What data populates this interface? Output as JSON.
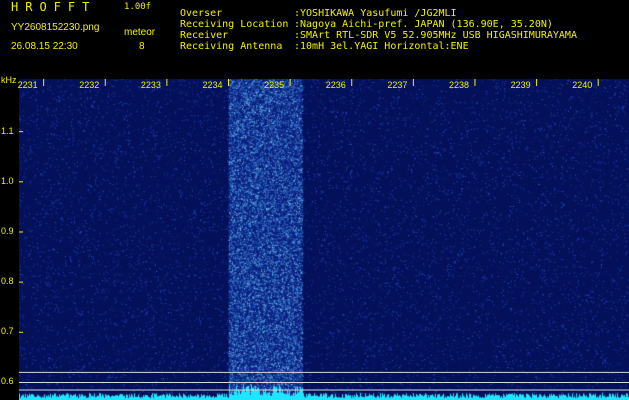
{
  "header": {
    "app_name": "HROFFT",
    "app_version": "1.00f",
    "file_name": "YY2608152230.png",
    "mode": "meteor",
    "datetime": "26.08.15 22:30",
    "count": "8",
    "info": [
      {
        "label": "Overser",
        "value": ":YOSHIKAWA Yasufumi /JG2MLI"
      },
      {
        "label": "Receiving Location",
        "value": ":Nagoya Aichi-pref. JAPAN (136.90E, 35.20N)"
      },
      {
        "label": "Receiver",
        "value": ":SMArt RTL-SDR V5 52.905MHz USB HIGASHIMURAYAMA"
      },
      {
        "label": "Receiving Antenna",
        "value": ":10mH 3el.YAGI Horizontal:ENE"
      }
    ]
  },
  "axis": {
    "unit": "kHz",
    "y_ticks": [
      "1.1",
      "1.0",
      "0.9",
      "0.8",
      "0.7",
      "0.6"
    ],
    "y_values": [
      1.1,
      1.0,
      0.9,
      0.8,
      0.7,
      0.6
    ],
    "y_range": [
      0.565,
      1.205
    ],
    "x_ticks": [
      "2231",
      "2232",
      "2233",
      "2234",
      "2235",
      "2236",
      "2237",
      "2238",
      "2239",
      "2240"
    ],
    "x_values": [
      2231,
      2232,
      2233,
      2234,
      2235,
      2236,
      2237,
      2238,
      2239,
      2240
    ],
    "x_range": [
      2230.6,
      2240.5
    ]
  },
  "signal": {
    "band_start": 2234.0,
    "band_end": 2235.2,
    "guide_levels": [
      0.62,
      0.6,
      0.585
    ]
  },
  "colors": {
    "background": "#04105a",
    "label": "#f2f200",
    "noise": "#3c6cff",
    "signal": "#4fd8ff",
    "baseline": "#1fe6ff",
    "guide": "#d8d8d8"
  }
}
